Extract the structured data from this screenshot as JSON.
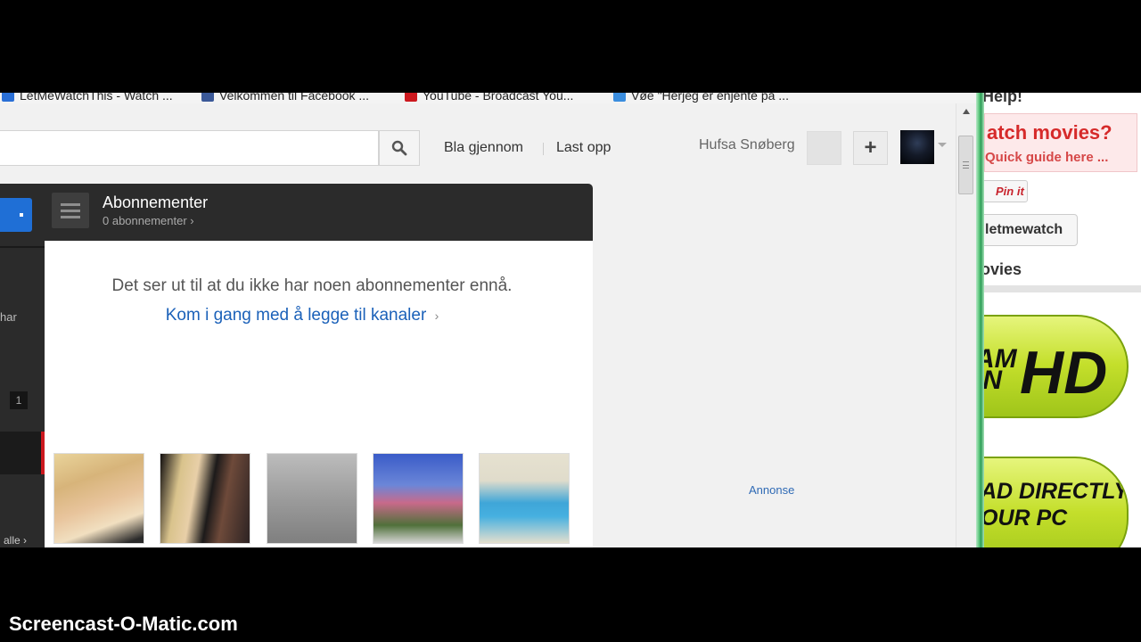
{
  "bookmarks": [
    {
      "label": "LetMeWatchThis - Watch ...",
      "icon": "globe-icon",
      "color": "#2a6fd6"
    },
    {
      "label": "Velkommen til Facebook ...",
      "icon": "facebook-icon",
      "color": "#3b5998"
    },
    {
      "label": "YouTube - Broadcast You...",
      "icon": "youtube-icon",
      "color": "#cc181e"
    },
    {
      "label": "Vøe \"Herjeg er enjente på ...",
      "icon": "ie-page-icon",
      "color": "#3a8dde"
    }
  ],
  "header": {
    "browse": "Bla gjennom",
    "upload": "Last opp",
    "username": "Hufsa Snøberg",
    "plus": "+"
  },
  "guide": {
    "har": "har",
    "badge": "1",
    "alle": "alle ›"
  },
  "subscriptions": {
    "title": "Abonnementer",
    "count": "0 abonnementer ›",
    "empty_message": "Det ser ut til at du ikke har noen abonnementer ennå.",
    "start_link": "Kom i gang med å legge til kanaler",
    "start_link_arrow": "›"
  },
  "annonse": "Annonse",
  "right_ads": {
    "help": "Help!",
    "watch_title": "atch movies?",
    "watch_sub": "Quick guide here ...",
    "pinit": "Pin it",
    "letmewatch_btn": "letmewatch",
    "movies_heading": "ovies",
    "hd_part1": "AM IN",
    "hd_part2": "HD",
    "download_line1": "AD DIRECTLY",
    "download_line2": "OUR PC"
  },
  "watermark": "Screencast-O-Matic.com",
  "colors": {
    "youtube_red": "#cc181e",
    "link_blue": "#1b61b9",
    "guide_dark": "#2b2b2b",
    "ad_green": "#c4df2b"
  }
}
